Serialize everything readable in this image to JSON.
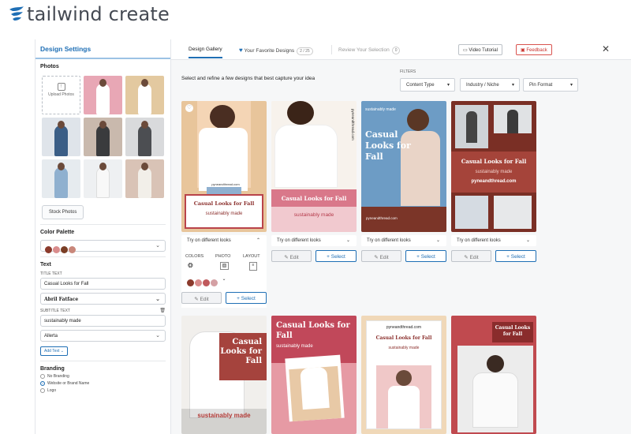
{
  "brand": {
    "name": "tailwind create",
    "color": "#1f6fb5"
  },
  "sidebar": {
    "title": "Design Settings",
    "photos_heading": "Photos",
    "upload_label": "Upload Photos",
    "stock_photos": "Stock Photos",
    "color_palette_heading": "Color Palette",
    "palette": [
      "#8b3a2c",
      "#d98c8c",
      "#7a3e25",
      "#c9877a"
    ],
    "text_heading": "Text",
    "title_label": "TITLE TEXT",
    "title_value": "Casual Looks for Fall",
    "title_font": "Abril Fatface",
    "subtitle_label": "SUBTITLE TEXT",
    "subtitle_value": "sustainably made",
    "subtitle_font": "Allerta",
    "add_text": "Add Text",
    "branding_heading": "Branding",
    "branding_options": [
      "No Branding",
      "Website or Brand Name",
      "Logo"
    ],
    "branding_selected": 1
  },
  "topbar": {
    "tab_gallery": "Design Gallery",
    "tab_favorites": "Your Favorite Designs",
    "favorites_count": "2 / 25",
    "tab_review": "Review Your Selection",
    "review_count": "0",
    "video_tutorial": "Video Tutorial",
    "feedback": "Feedback",
    "close": "✕"
  },
  "gallery": {
    "instruction": "Select and refine a few designs that best capture your idea",
    "filters_label": "FILTERS",
    "filters": [
      "Content Type",
      "Industry / Niche",
      "Pin Format"
    ],
    "pin_title": "Casual Looks for Fall",
    "pin_subtitle": "sustainably made",
    "pin_site": "pyneandthread.com",
    "pin_small": "sustainably made",
    "try_label": "Try on different looks",
    "edit": "Edit",
    "select": "Select",
    "pop_colors": "COLORS",
    "pop_photo": "PHOTO",
    "pop_layout": "LAYOUT"
  }
}
